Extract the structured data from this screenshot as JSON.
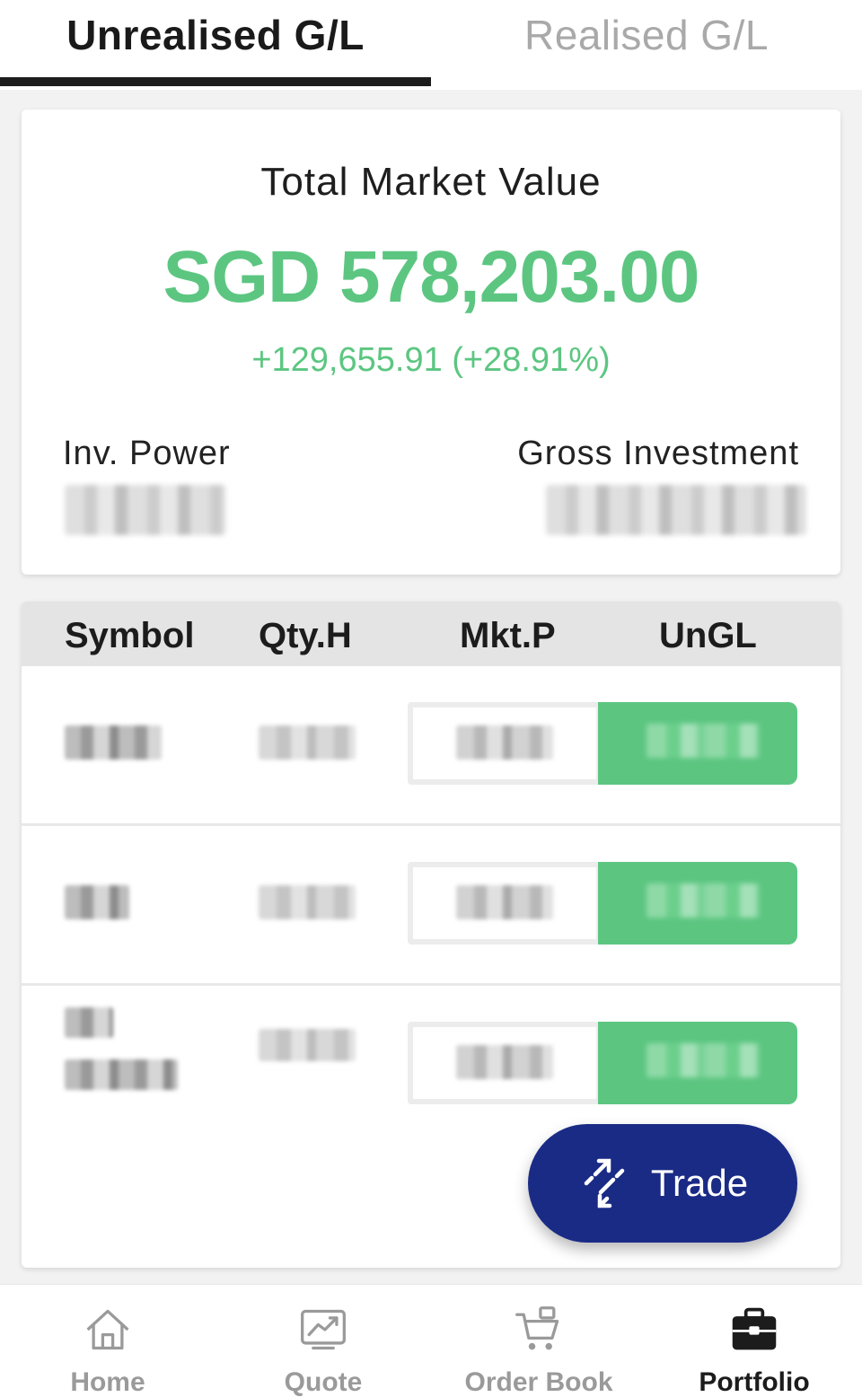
{
  "tabs": {
    "unrealised": "Unrealised G/L",
    "realised": "Realised G/L",
    "active": "unrealised"
  },
  "summary": {
    "title": "Total Market Value",
    "value": "SGD 578,203.00",
    "change": "+129,655.91 (+28.91%)",
    "inv_power_label": "Inv. Power",
    "gross_investment_label": "Gross Investment"
  },
  "holdings": {
    "columns": [
      "Symbol",
      "Qty.H",
      "Mkt.P",
      "UnGL"
    ],
    "row_count": 3
  },
  "trade_button": {
    "label": "Trade",
    "icon": "trade-arrows-icon"
  },
  "bottom_nav": {
    "items": [
      {
        "label": "Home",
        "icon": "home-icon",
        "active": false
      },
      {
        "label": "Quote",
        "icon": "chart-icon",
        "active": false
      },
      {
        "label": "Order Book",
        "icon": "cart-icon",
        "active": false
      },
      {
        "label": "Portfolio",
        "icon": "briefcase-icon",
        "active": true
      }
    ]
  },
  "colors": {
    "positive": "#5cc681",
    "trade_button": "#1a2b86",
    "tab_active": "#1c1c1c",
    "tab_inactive": "#a9a9a9"
  }
}
